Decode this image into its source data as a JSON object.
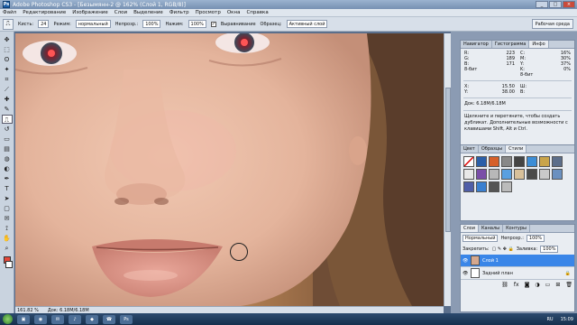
{
  "window": {
    "title": "Adobe Photoshop CS3 - [Безымянн-2 @ 162% (Слой 1, RGB/8)]"
  },
  "menu": [
    "Файл",
    "Редактирование",
    "Изображение",
    "Слои",
    "Выделение",
    "Фильтр",
    "Просмотр",
    "Окна",
    "Справка"
  ],
  "options": {
    "brush_label": "Кисть:",
    "brush_size": "24",
    "mode_label": "Режим:",
    "mode_value": "нормальный",
    "opacity_label": "Непрозр.:",
    "opacity_value": "100%",
    "flow_label": "Нажим:",
    "flow_value": "100%",
    "aligned_label": "Выравнивание",
    "sample_label": "Образец:",
    "sample_value": "Активный слой",
    "workspace": "Рабочая среда"
  },
  "status": {
    "zoom": "161.82 %",
    "doc": "Док: 6.18M/6.18M"
  },
  "info_panel": {
    "tabs": [
      "Навигатор",
      "Гистограмма",
      "Инфо"
    ],
    "rgb": [
      {
        "k": "R:",
        "v": "223"
      },
      {
        "k": "G:",
        "v": "189"
      },
      {
        "k": "B:",
        "v": "171"
      }
    ],
    "cmyk": [
      {
        "k": "C:",
        "v": "16%"
      },
      {
        "k": "M:",
        "v": "30%"
      },
      {
        "k": "Y:",
        "v": "37%"
      },
      {
        "k": "K:",
        "v": "0%"
      }
    ],
    "bits1": "8-бит",
    "bits2": "8-бит",
    "xy": [
      {
        "k": "X:",
        "v": "15.50"
      },
      {
        "k": "Y:",
        "v": "38.00"
      }
    ],
    "wh": [
      {
        "k": "Ш:",
        "v": ""
      },
      {
        "k": "В:",
        "v": ""
      }
    ],
    "doc": "Док: 6.18M/6.18M",
    "hint": "Щелкните и перетяните, чтобы создать дубликат. Дополнительные возможности с клавишами Shift, Alt и Ctrl."
  },
  "styles_panel": {
    "tabs": [
      "Цвет",
      "Образцы",
      "Стили"
    ]
  },
  "layers_panel": {
    "tabs": [
      "Слои",
      "Каналы",
      "Контуры"
    ],
    "blend": "Нормальный",
    "opacity_label": "Непрозр.:",
    "opacity_value": "100%",
    "lock_label": "Закрепить:",
    "fill_label": "Заливка:",
    "fill_value": "100%",
    "layers": [
      {
        "name": "Слой 1",
        "selected": true
      },
      {
        "name": "Задний план",
        "selected": false
      }
    ]
  },
  "taskbar": {
    "lang": "RU",
    "time": "15:09"
  }
}
